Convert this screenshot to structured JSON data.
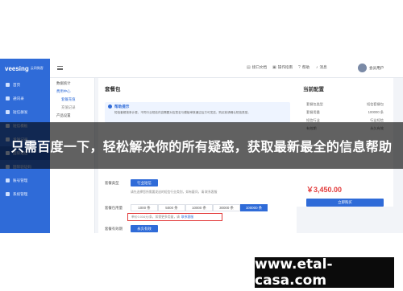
{
  "app": {
    "logo": "veesing",
    "logo_sub": "云网微客"
  },
  "sidebar": {
    "items": [
      {
        "label": "首页"
      },
      {
        "label": "通讯录"
      },
      {
        "label": "短信群发"
      },
      {
        "label": "短信模板"
      },
      {
        "label": "发送记录"
      },
      {
        "label": "国际短信"
      },
      {
        "label": "国际验证码"
      },
      {
        "label": "账号管理"
      },
      {
        "label": "系统管理"
      }
    ]
  },
  "topbar": {
    "doc": "接口文档",
    "guide": "操作指南",
    "help": "帮助",
    "msg": "消息",
    "user": "会员用户"
  },
  "submenu": {
    "items": [
      {
        "label": "数据统计"
      },
      {
        "label": "费用中心"
      },
      {
        "label": "套餐充值"
      },
      {
        "label": "充值记录"
      },
      {
        "label": "产品设置"
      }
    ]
  },
  "main": {
    "title": "套餐包",
    "tips_title": "帮助提示",
    "tips_text": "短信套餐按条计费，不同行业短信内容需要对应签名与模板审核通过后方可发送，购买前请确认短信类型。",
    "type_label": "套餐类型",
    "type_value": "行业短信",
    "type_hint": "请先选择您所需要发送的短信行业类别，如有疑问，请 联系客服",
    "qty_label": "套餐包用量",
    "qty_options": [
      "1000 条",
      "5000 条",
      "10000 条",
      "30000 条",
      "100000 条"
    ],
    "price_note": "单价0.034元/条，如需更多用量，请",
    "price_link": "联系客服",
    "validity_label": "套餐有效期",
    "validity_value": "永久有效"
  },
  "card": {
    "title": "当前配置",
    "rows": [
      {
        "k": "套餐包类型",
        "v": "短信套餐包"
      },
      {
        "k": "套餐用量",
        "v": "100000 条"
      },
      {
        "k": "短信行业",
        "v": "行业短信"
      },
      {
        "k": "有效期",
        "v": "永久有效"
      }
    ],
    "price": "￥3,450.00",
    "pay": "立即购买"
  },
  "overlay": {
    "banner": "只需百度一下，轻松解决你的所有疑惑，获取最新最全的信息帮助"
  },
  "watermark": {
    "url": "www.etal-casa.com"
  }
}
